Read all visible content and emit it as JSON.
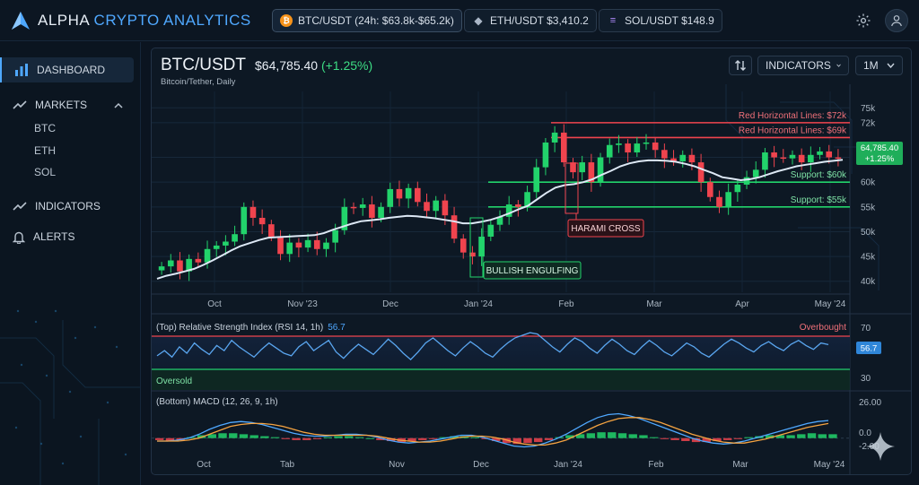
{
  "brand": {
    "name_part1": "ALPHA",
    "name_part2": "CRYPTO ANALYTICS"
  },
  "tickers": [
    {
      "symbol": "BTC",
      "label": "BTC/USDT (24h: $63.8k-$65.2k)",
      "color": "#f7931a",
      "active": true
    },
    {
      "symbol": "ETH",
      "label": "ETH/USDT $3,410.2",
      "color": "#8c9bb0",
      "active": false
    },
    {
      "symbol": "SOL",
      "label": "SOL/USDT $148.9",
      "color": "#9b6bff",
      "active": false
    }
  ],
  "sidebar": {
    "items": [
      {
        "label": "DASHBOARD",
        "icon": "bar-chart-icon"
      },
      {
        "label": "MARKETS",
        "icon": "trend-icon"
      },
      {
        "label": "INDICATORS",
        "icon": "trend-icon"
      },
      {
        "label": "ALERTS",
        "icon": "bell-icon"
      }
    ],
    "markets_sub": [
      "BTC",
      "ETH",
      "SOL"
    ]
  },
  "chart_header": {
    "pair": "BTC/USDT",
    "price": "$64,785.40",
    "change": "(+1.25%)",
    "subtitle": "Bitcoin/Tether, Daily",
    "indicators_label": "INDICATORS",
    "timeframe": "1M"
  },
  "colors": {
    "up": "#22d36b",
    "down": "#f0444e",
    "accent": "#4fa8ff",
    "ma": "#dde8f5"
  },
  "chart_data": [
    {
      "type": "candlestick",
      "title": "BTC/USDT",
      "x_tick_labels": [
        "Oct",
        "Nov '23",
        "Dec",
        "Jan '24",
        "Feb",
        "Mar",
        "Apr",
        "May '24"
      ],
      "y_tick_labels": [
        "75k",
        "72k",
        "65k",
        "60k",
        "55k",
        "50k",
        "45k",
        "40k"
      ],
      "y_ticks": [
        75000,
        72000,
        65000,
        60000,
        55000,
        50000,
        45000,
        40000
      ],
      "ylim": [
        38500,
        76500
      ],
      "last_price_label": "64,785.40",
      "last_change_label": "+1.25%",
      "horizontal_lines": [
        {
          "label": "Red Horizontal Lines: $69k",
          "value": 69000,
          "color": "red"
        },
        {
          "label": "Red Horizontal Lines: $72k",
          "value": 72000,
          "color": "red"
        },
        {
          "label": "Support: $60k",
          "value": 60000,
          "color": "green"
        },
        {
          "label": "Support: $55k",
          "value": 55000,
          "color": "green"
        }
      ],
      "annotations": [
        "BULLISH ENGULFING",
        "HARAMI CROSS"
      ],
      "closes": [
        43000,
        44200,
        42000,
        44500,
        43800,
        46500,
        47200,
        48000,
        49500,
        55000,
        52800,
        51500,
        49000,
        45500,
        47800,
        46800,
        48300,
        46500,
        47800,
        50300,
        55000,
        54800,
        55500,
        52800,
        55000,
        58600,
        56700,
        58800,
        56000,
        54200,
        56300,
        53300,
        48600,
        45800,
        45000,
        49000,
        51400,
        53000,
        55500,
        55000,
        58000,
        63000,
        68000,
        70000,
        64000,
        62000,
        64000,
        60000,
        65000,
        67500,
        67800,
        66000,
        67800,
        68000,
        66500,
        64800,
        64200,
        65500,
        64000,
        60000,
        57000,
        55000,
        58000,
        59500,
        61000,
        62500,
        66000,
        65000,
        64800,
        65500,
        64000,
        65500,
        66200,
        65000,
        64785
      ],
      "ma_values": [
        40500,
        41100,
        41500,
        42000,
        42500,
        43300,
        44200,
        45200,
        46200,
        47100,
        47700,
        48300,
        48800,
        48900,
        49000,
        49100,
        49200,
        49300,
        49700,
        50400,
        51000,
        51600,
        52100,
        52300,
        52500,
        52800,
        53000,
        53200,
        53100,
        52900,
        52700,
        52400,
        52100,
        51700,
        51700,
        52000,
        52400,
        53000,
        53700,
        54500,
        55200,
        56500,
        57800,
        58900,
        59400,
        59600,
        60000,
        60600,
        61500,
        62300,
        63200,
        63800,
        64200,
        64400,
        64400,
        64300,
        64100,
        63700,
        63200,
        62500,
        61800,
        61000,
        60700,
        60400,
        60600,
        61000,
        61600,
        62200,
        62700,
        63200,
        63500,
        63800,
        64100,
        64300,
        64500
      ]
    },
    {
      "type": "line",
      "title": "(Top) Relative Strength Index (RSI 14, 1h)",
      "current_value": "56.7",
      "y_tick_labels": [
        "70",
        "30"
      ],
      "ylim": [
        22,
        78
      ],
      "levels": [
        {
          "label": "Overbought",
          "value": 70
        },
        {
          "label": "Oversold",
          "value": 30
        }
      ],
      "values": [
        48,
        52,
        47,
        55,
        50,
        58,
        53,
        49,
        56,
        52,
        60,
        55,
        51,
        47,
        53,
        58,
        54,
        50,
        48,
        55,
        59,
        52,
        56,
        60,
        51,
        46,
        52,
        57,
        53,
        49,
        55,
        61,
        56,
        50,
        45,
        51,
        58,
        62,
        57,
        52,
        48,
        54,
        59,
        55,
        50,
        47,
        53,
        58,
        62,
        64,
        66,
        65,
        60,
        55,
        51,
        57,
        62,
        59,
        54,
        50,
        56,
        61,
        57,
        52,
        49,
        55,
        60,
        56,
        51,
        48,
        53,
        58,
        55,
        50,
        47,
        52,
        57,
        61,
        58,
        54,
        51,
        56,
        59,
        55,
        52,
        57,
        60,
        56,
        53,
        58,
        56.7
      ]
    },
    {
      "type": "bar+line",
      "title": "(Bottom) MACD (12, 26, 9, 1h)",
      "y_tick_labels": [
        "26.00",
        "0.0",
        "-2.00"
      ],
      "ylim": [
        -14,
        30
      ],
      "x_tick_labels": [
        "Oct",
        "Tab",
        "Nov",
        "Dec",
        "Jan '24",
        "Feb",
        "Mar",
        "May '24"
      ],
      "histogram": [
        -2,
        -3,
        -2,
        1,
        3,
        4,
        5,
        5,
        4,
        3,
        2,
        1,
        -1,
        -2,
        -2,
        -1,
        1,
        2,
        2,
        1,
        0,
        -2,
        -3,
        -4,
        -3,
        -2,
        -1,
        1,
        2,
        2,
        1,
        -1,
        -3,
        -5,
        -6,
        -5,
        -4,
        -2,
        1,
        3,
        4,
        5,
        6,
        6,
        5,
        4,
        3,
        1,
        -1,
        -2,
        -3,
        -4,
        -4,
        -3,
        -2,
        -1,
        1,
        2,
        3,
        3,
        3,
        4,
        5,
        4,
        4
      ],
      "macd_line": [
        -3,
        -3,
        -2,
        0,
        4,
        9,
        13,
        16,
        17,
        16,
        14,
        11,
        8,
        5,
        3,
        2,
        2,
        3,
        4,
        4,
        3,
        1,
        -2,
        -4,
        -5,
        -4,
        -3,
        -1,
        1,
        3,
        3,
        1,
        -2,
        -5,
        -8,
        -9,
        -8,
        -5,
        -1,
        4,
        10,
        16,
        21,
        24,
        25,
        23,
        20,
        16,
        12,
        8,
        4,
        0,
        -3,
        -5,
        -6,
        -5,
        -3,
        0,
        3,
        6,
        9,
        12,
        15,
        17,
        18
      ],
      "signal_line": [
        -3,
        -3,
        -3,
        -2,
        0,
        4,
        8,
        12,
        14,
        15,
        15,
        14,
        12,
        9,
        6,
        4,
        3,
        3,
        3,
        3,
        3,
        2,
        0,
        -2,
        -3,
        -4,
        -4,
        -3,
        -1,
        1,
        2,
        2,
        1,
        -1,
        -4,
        -6,
        -7,
        -7,
        -5,
        -2,
        3,
        8,
        13,
        17,
        20,
        21,
        21,
        19,
        16,
        12,
        8,
        4,
        1,
        -2,
        -4,
        -5,
        -5,
        -3,
        -1,
        2,
        5,
        8,
        11,
        13,
        15
      ]
    }
  ]
}
